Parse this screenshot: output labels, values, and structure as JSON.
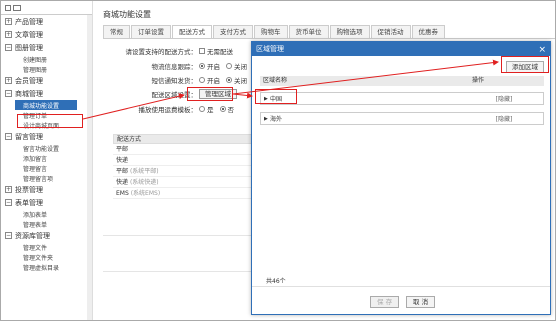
{
  "sidebar": {
    "groups": [
      {
        "label": "产品管理",
        "toggle": "+"
      },
      {
        "label": "文章管理",
        "toggle": "+"
      },
      {
        "label": "图册管理",
        "toggle": "−",
        "items": [
          "创建图册",
          "管理图册"
        ]
      },
      {
        "label": "会员管理",
        "toggle": "+"
      },
      {
        "label": "商城管理",
        "toggle": "−",
        "items": [
          "商城功能设置",
          "管理订单",
          "设计商城页面"
        ]
      },
      {
        "label": "留言管理",
        "toggle": "−",
        "items": [
          "留言功能设置",
          "添加留言",
          "管理留言",
          "管理留言项"
        ]
      },
      {
        "label": "投票管理",
        "toggle": "+"
      },
      {
        "label": "表单管理",
        "toggle": "−",
        "items": [
          "添加表单",
          "管理表单"
        ]
      },
      {
        "label": "资源库管理",
        "toggle": "−",
        "items": [
          "管理文件",
          "管理文件夹",
          "管理虚拟目录"
        ]
      }
    ]
  },
  "main": {
    "title": "商城功能设置",
    "tabs": [
      "常规",
      "订单设置",
      "配送方式",
      "支付方式",
      "购物车",
      "货币单位",
      "购物选项",
      "促销活动",
      "优惠券"
    ],
    "form": {
      "row1": {
        "label": "请设置支持的配送方式：",
        "opt": "无需配送"
      },
      "row2": {
        "label": "物流信息跟踪：",
        "on": "开启",
        "off": "关闭"
      },
      "row3": {
        "label": "短信通知发货：",
        "on": "开启",
        "off": "关闭"
      },
      "row4": {
        "label": "配送区域设置：",
        "button": "管理区域"
      },
      "row5": {
        "label": "播放使用运费模板：",
        "yes": "是",
        "no": "否"
      }
    },
    "table": {
      "header": "配送方式",
      "rows": [
        {
          "name": "平邮",
          "note": ""
        },
        {
          "name": "快递",
          "note": ""
        },
        {
          "name": "平邮",
          "note": "(系统平邮)"
        },
        {
          "name": "快递",
          "note": "(系统快递)"
        },
        {
          "name": "EMS",
          "note": "(系统EMS)"
        }
      ]
    }
  },
  "modal": {
    "title": "区域管理",
    "close": "×",
    "add_button": "添加区域",
    "col_name": "区域名称",
    "col_action": "操作",
    "rows": [
      {
        "name": "中国",
        "action": "[隐藏]"
      },
      {
        "name": "海外",
        "action": "[隐藏]"
      }
    ],
    "total": "共46个",
    "save": "保 存",
    "cancel": "取 消"
  },
  "colors": {
    "accent": "#2f6fb7",
    "annotation": "#e02020"
  }
}
